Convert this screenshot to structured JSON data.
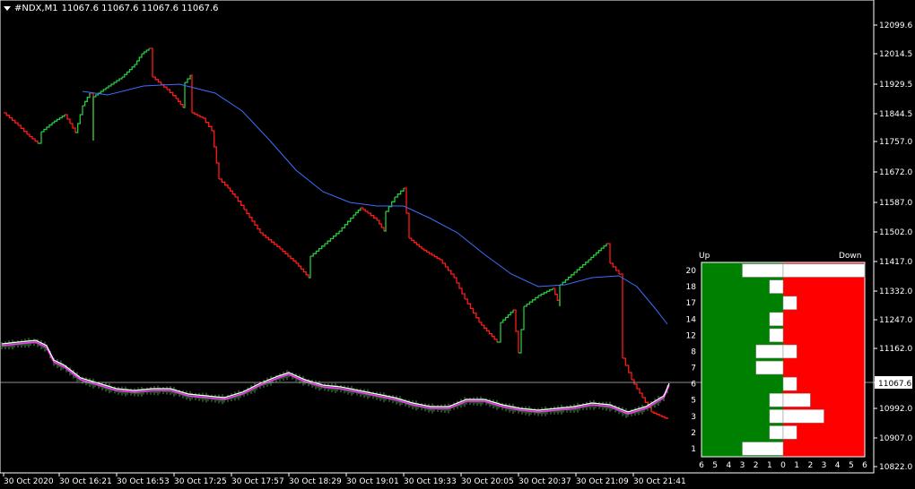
{
  "header": {
    "symbol": "#NDX,M1",
    "ohlc": "11067.6 11067.6 11067.6 11067.6"
  },
  "colors": {
    "background": "#000000",
    "up": "#27c93f",
    "down": "#ff1a1a",
    "ma": "#3d6fff",
    "oscillator": "#ff33ff",
    "signal": "#ffffff",
    "histogram": "#58c558",
    "panel_up": "#008000",
    "panel_down": "#ff0000"
  },
  "price_axis": {
    "ticks": [
      "12099.6",
      "12014.5",
      "11929.5",
      "11844.5",
      "11757.0",
      "11672.0",
      "11587.0",
      "11502.0",
      "11417.0",
      "11332.0",
      "11247.0",
      "11162.0",
      "11067.6",
      "10992.0",
      "10907.0",
      "10822.0"
    ],
    "current_price": "11067.6"
  },
  "time_axis": {
    "ticks": [
      "30 Oct 2020",
      "30 Oct 16:21",
      "30 Oct 16:53",
      "30 Oct 17:25",
      "30 Oct 17:57",
      "30 Oct 18:29",
      "30 Oct 19:01",
      "30 Oct 19:33",
      "30 Oct 20:05",
      "30 Oct 20:37",
      "30 Oct 21:09",
      "30 Oct 21:41"
    ]
  },
  "panel": {
    "up_label": "Up",
    "down_label": "Down",
    "levels": [
      "20",
      "18",
      "17",
      "14",
      "12",
      "8",
      "7",
      "6",
      "5",
      "3",
      "2",
      "1"
    ],
    "x_ticks": [
      "6",
      "5",
      "4",
      "3",
      "2",
      "1",
      "0",
      "1",
      "2",
      "3",
      "4",
      "5",
      "6"
    ],
    "up_values": [
      3,
      1,
      0,
      1,
      1,
      2,
      2,
      0,
      1,
      1,
      1,
      3
    ],
    "down_values": [
      6,
      0,
      1,
      0,
      0,
      1,
      0,
      1,
      2,
      3,
      1,
      0
    ]
  }
}
